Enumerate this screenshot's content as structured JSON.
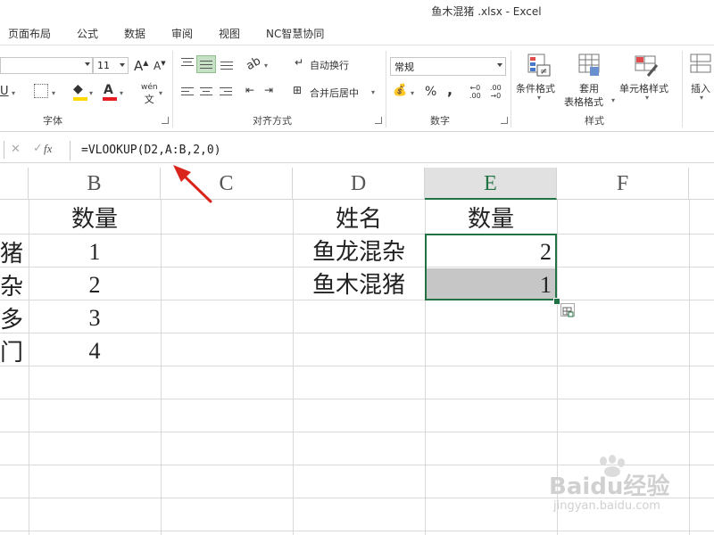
{
  "window": {
    "title": "鱼木混猪 .xlsx - Excel"
  },
  "tabs": [
    "页面布局",
    "公式",
    "数据",
    "审阅",
    "视图",
    "NC智慧协同"
  ],
  "ribbon": {
    "font": {
      "name_value": "",
      "size_value": "11",
      "grow_label": "A",
      "shrink_label": "A",
      "group_label": "字体",
      "underline_label": "U",
      "phonetic_label": "wén"
    },
    "alignment": {
      "wrap_label": "自动换行",
      "merge_label": "合并后居中",
      "group_label": "对齐方式"
    },
    "number": {
      "format_value": "常规",
      "percent_label": "%",
      "comma_label": ",",
      "group_label": "数字"
    },
    "styles": {
      "conditional_label": "条件格式",
      "table_label_1": "套用",
      "table_label_2": "表格格式",
      "cell_styles_label": "单元格样式",
      "group_label": "样式"
    },
    "cells": {
      "insert_label": "插入"
    }
  },
  "formula_bar": {
    "fx_label": "fx",
    "formula": "=VLOOKUP(D2,A:B,2,0)"
  },
  "columns": [
    "B",
    "C",
    "D",
    "E",
    "F"
  ],
  "sheet": {
    "col_a_fragments": [
      "猪",
      "杂",
      "多",
      "门"
    ],
    "col_b": {
      "header": "数量",
      "values": [
        "1",
        "2",
        "3",
        "4"
      ]
    },
    "col_d": {
      "header": "姓名",
      "values": [
        "鱼龙混杂",
        "鱼木混猪"
      ]
    },
    "col_e": {
      "header": "数量",
      "values": [
        "2",
        "1"
      ]
    }
  },
  "watermark": {
    "brand": "Baidu经验",
    "url": "jingyan.baidu.com"
  },
  "colors": {
    "accent": "#217346",
    "arrow": "#d9251c"
  }
}
